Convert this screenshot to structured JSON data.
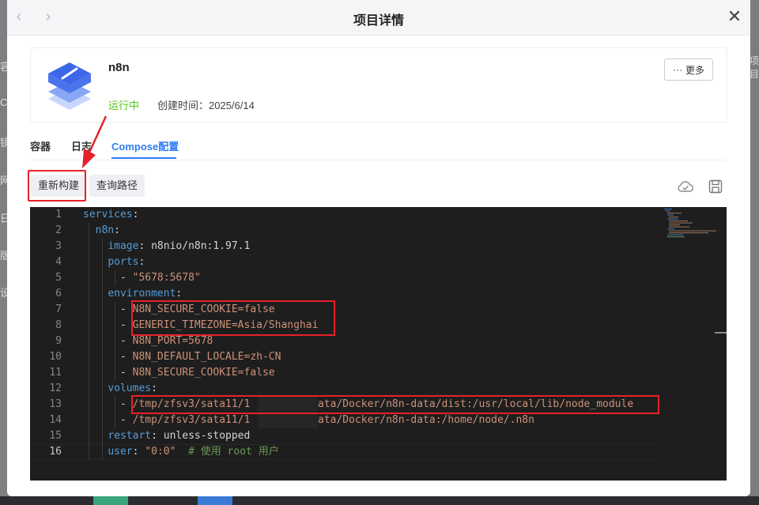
{
  "background": {
    "left_fragments": [
      "容",
      "Co",
      "镜",
      "网",
      "日",
      "版",
      "设"
    ],
    "right_fragments": [
      "项目"
    ]
  },
  "modal": {
    "title": "项目详情",
    "back_icon": "chevron-left-icon",
    "forward_icon": "chevron-right-icon",
    "close_icon": "close-icon",
    "close_glyph": "✕"
  },
  "project": {
    "name": "n8n",
    "status": "运行中",
    "created": "创建时间：2025/6/14",
    "more_label": "更多",
    "more_icon": "ellipsis-icon",
    "status_color": "#52c41a"
  },
  "tabs": [
    {
      "label": "容器",
      "active": false
    },
    {
      "label": "日志",
      "active": false
    },
    {
      "label": "Compose配置",
      "active": true
    }
  ],
  "toolbar": {
    "rebuild_label": "重新构建",
    "query_path_label": "查询路径",
    "icons": [
      "cloud-check-icon",
      "save-icon"
    ]
  },
  "editor": {
    "current_line": 16,
    "lines": [
      {
        "n": "1"
      },
      {
        "n": "2"
      },
      {
        "n": "3"
      },
      {
        "n": "4"
      },
      {
        "n": "5"
      },
      {
        "n": "6"
      },
      {
        "n": "7"
      },
      {
        "n": "8"
      },
      {
        "n": "9"
      },
      {
        "n": "10"
      },
      {
        "n": "11"
      },
      {
        "n": "12"
      },
      {
        "n": "13"
      },
      {
        "n": "14"
      },
      {
        "n": "15"
      },
      {
        "n": "16"
      }
    ],
    "code": {
      "l1_key": "services",
      "l1_colon": ":",
      "l2_key": "n8n",
      "l2_colon": ":",
      "l3_key": "image",
      "l3_colon": ": ",
      "l3_val": "n8nio/n8n:1.97.1",
      "l4_key": "ports",
      "l4_colon": ":",
      "l5_dash": "- ",
      "l5_val": "\"5678:5678\"",
      "l6_key": "environment",
      "l6_colon": ":",
      "l7_dash": "- ",
      "l7_val": "N8N_SECURE_COOKIE=false",
      "l8_dash": "- ",
      "l8_val": "GENERIC_TIMEZONE=Asia/Shanghai",
      "l9_dash": "- ",
      "l9_val": "N8N_PORT=5678",
      "l10_dash": "- ",
      "l10_val": "N8N_DEFAULT_LOCALE=zh-CN",
      "l11_dash": "- ",
      "l11_val": "N8N_SECURE_COOKIE=false",
      "l12_key": "volumes",
      "l12_colon": ":",
      "l13_dash": "- ",
      "l13_val_a": "/tmp/zfsv3/sata11/1",
      "l13_val_b": "/data/Docker/n8n-data/dist:/usr/local/lib/node_module",
      "l14_dash": "- ",
      "l14_val_a": "/tmp/zfsv3/sata11/1",
      "l14_val_b": "/data/Docker/n8n-data:/home/node/.n8n",
      "l15_key": "restart",
      "l15_colon": ": ",
      "l15_val": "unless-stopped",
      "l16_key": "user",
      "l16_colon": ": ",
      "l16_val": "\"0:0\"",
      "l16_comment": "  # 使用 root 用户"
    }
  },
  "colors": {
    "accent": "#2f7cf6",
    "highlight": "#e5212a",
    "editor_bg": "#1e1e1e"
  }
}
